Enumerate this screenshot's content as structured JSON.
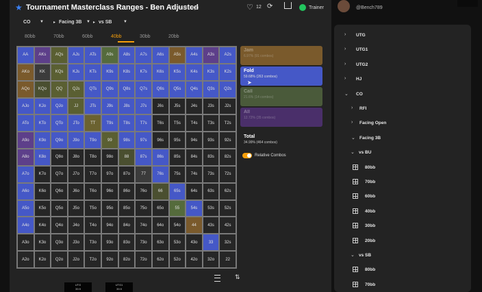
{
  "header": {
    "title": "Tournament Masterclass Ranges - Ben Adjusted",
    "time_ago": "7 months ago",
    "likes": "12",
    "trainer_label": "Trainer"
  },
  "nav": {
    "position": "CO",
    "facing": "Facing 3B",
    "villain": "vs SB"
  },
  "depth_tabs": [
    "80bb",
    "70bb",
    "60bb",
    "40bb",
    "30bb",
    "20bb"
  ],
  "active_depth": "40bb",
  "hands": [
    [
      "AA",
      "AKs",
      "AQs",
      "AJs",
      "ATs",
      "A9s",
      "A8s",
      "A7s",
      "A6s",
      "A5s",
      "A4s",
      "A3s",
      "A2s"
    ],
    [
      "AKo",
      "KK",
      "KQs",
      "KJs",
      "KTs",
      "K9s",
      "K8s",
      "K7s",
      "K6s",
      "K5s",
      "K4s",
      "K3s",
      "K2s"
    ],
    [
      "AQo",
      "KQo",
      "QQ",
      "QJs",
      "QTs",
      "Q9s",
      "Q8s",
      "Q7s",
      "Q6s",
      "Q5s",
      "Q4s",
      "Q3s",
      "Q2s"
    ],
    [
      "AJo",
      "KJo",
      "QJo",
      "JJ",
      "JTs",
      "J9s",
      "J8s",
      "J7s",
      "J6s",
      "J5s",
      "J4s",
      "J3s",
      "J2s"
    ],
    [
      "ATo",
      "KTo",
      "QTo",
      "JTo",
      "TT",
      "T9s",
      "T8s",
      "T7s",
      "T6s",
      "T5s",
      "T4s",
      "T3s",
      "T2s"
    ],
    [
      "A9o",
      "K9o",
      "Q9o",
      "J9o",
      "T9o",
      "99",
      "98s",
      "97s",
      "96s",
      "95s",
      "94s",
      "93s",
      "92s"
    ],
    [
      "A8o",
      "K8o",
      "Q8o",
      "J8o",
      "T8o",
      "98o",
      "88",
      "87s",
      "86s",
      "85s",
      "84s",
      "83s",
      "82s"
    ],
    [
      "A7o",
      "K7o",
      "Q7o",
      "J7o",
      "T7o",
      "97o",
      "87o",
      "77",
      "76s",
      "75s",
      "74s",
      "73s",
      "72s"
    ],
    [
      "A6o",
      "K6o",
      "Q6o",
      "J6o",
      "T6o",
      "96o",
      "86o",
      "76o",
      "66",
      "65s",
      "64s",
      "63s",
      "62s"
    ],
    [
      "A5o",
      "K5o",
      "Q5o",
      "J5o",
      "T5o",
      "95o",
      "85o",
      "75o",
      "65o",
      "55",
      "54s",
      "53s",
      "52s"
    ],
    [
      "A4o",
      "K4o",
      "Q4o",
      "J4o",
      "T4o",
      "94o",
      "84o",
      "74o",
      "64o",
      "54o",
      "44",
      "43s",
      "42s"
    ],
    [
      "A3o",
      "K3o",
      "Q3o",
      "J3o",
      "T3o",
      "93o",
      "83o",
      "73o",
      "63o",
      "53o",
      "43o",
      "33",
      "32s"
    ],
    [
      "A2o",
      "K2o",
      "Q2o",
      "J2o",
      "T2o",
      "92o",
      "82o",
      "72o",
      "62o",
      "52o",
      "42o",
      "32o",
      "22"
    ]
  ],
  "cell_colors": [
    [
      "#4558c7",
      "#5d3f8a",
      "#5a5f32",
      "#4558c7",
      "#4558c7",
      "#556b3c",
      "#4558c7",
      "#4558c7",
      "#4558c7",
      "#7a5a2c",
      "#4558c7",
      "#5d3f8a",
      "#4558c7"
    ],
    [
      "#7a5a2c",
      "#3b3b3b",
      "#5a5f32",
      "#4558c7",
      "#4558c7",
      "#4558c7",
      "#4558c7",
      "#4558c7",
      "#4558c7",
      "#4558c7",
      "#4558c7",
      "#4558c7",
      "#4558c7"
    ],
    [
      "#7a5a2c",
      "#4a4f30",
      "#5a5f32",
      "#5a5f32",
      "#4558c7",
      "#4558c7",
      "#4558c7",
      "#4558c7",
      "#4558c7",
      "#4558c7",
      "#4558c7",
      "#4558c7",
      "#4558c7"
    ],
    [
      "#4558c7",
      "#4558c7",
      "#4558c7",
      "#5a5f32",
      "#4558c7",
      "#4558c7",
      "#4558c7",
      "#4558c7",
      "#262626",
      "#262626",
      "#262626",
      "#262626",
      "#262626"
    ],
    [
      "#4558c7",
      "#4558c7",
      "#4558c7",
      "#4558c7",
      "#6b6230",
      "#4558c7",
      "#4558c7",
      "#4558c7",
      "#262626",
      "#262626",
      "#262626",
      "#262626",
      "#262626"
    ],
    [
      "#5d3f8a",
      "#4558c7",
      "#4558c7",
      "#4558c7",
      "#4558c7",
      "#5a5f32",
      "#4558c7",
      "#4558c7",
      "#262626",
      "#262626",
      "#262626",
      "#262626",
      "#262626"
    ],
    [
      "#5d3f8a",
      "#4558c7",
      "#262626",
      "#262626",
      "#262626",
      "#262626",
      "#4a4f30",
      "#4558c7",
      "#4558c7",
      "#262626",
      "#262626",
      "#262626",
      "#262626"
    ],
    [
      "#4558c7",
      "#262626",
      "#262626",
      "#262626",
      "#262626",
      "#262626",
      "#262626",
      "#3b3b3b",
      "#4558c7",
      "#262626",
      "#262626",
      "#262626",
      "#262626"
    ],
    [
      "#4558c7",
      "#262626",
      "#262626",
      "#262626",
      "#262626",
      "#262626",
      "#262626",
      "#262626",
      "#4a4f30",
      "#4558c7",
      "#262626",
      "#262626",
      "#262626"
    ],
    [
      "#4558c7",
      "#262626",
      "#262626",
      "#262626",
      "#262626",
      "#262626",
      "#262626",
      "#262626",
      "#262626",
      "#556b3c",
      "#4558c7",
      "#262626",
      "#262626"
    ],
    [
      "#4558c7",
      "#262626",
      "#262626",
      "#262626",
      "#262626",
      "#262626",
      "#262626",
      "#262626",
      "#262626",
      "#262626",
      "#7a5a2c",
      "#262626",
      "#262626"
    ],
    [
      "#262626",
      "#262626",
      "#262626",
      "#262626",
      "#262626",
      "#262626",
      "#262626",
      "#262626",
      "#262626",
      "#262626",
      "#262626",
      "#4558c7",
      "#262626"
    ],
    [
      "#262626",
      "#262626",
      "#262626",
      "#262626",
      "#262626",
      "#262626",
      "#262626",
      "#262626",
      "#262626",
      "#262626",
      "#262626",
      "#262626",
      "#262626"
    ]
  ],
  "actions": [
    {
      "name": "Jam",
      "pct": "6.97% (91 combos)",
      "color": "#7a5a2c",
      "dim": true
    },
    {
      "name": "Fold",
      "pct": "59.68% (263 combos)",
      "color": "#4558c7",
      "dim": false
    },
    {
      "name": "Call",
      "pct": "21.6% (14 combos)",
      "color": "#4a5a3a",
      "dim": true
    },
    {
      "name": "All",
      "pct": "12.72% (35 combos)",
      "color": "#4a2f6a",
      "dim": true
    }
  ],
  "total": {
    "label": "Total",
    "pct": "34.99% (464 combos)"
  },
  "relative_combos_label": "Relative Combos",
  "thumbnails": [
    {
      "label": "UTG",
      "value": "39.9"
    },
    {
      "label": "UTG1",
      "value": "39.9"
    }
  ],
  "sidebar": {
    "username": "@Bench789",
    "tree": [
      {
        "label": "UTG",
        "level": 0,
        "icon": "chevron-right"
      },
      {
        "label": "UTG1",
        "level": 0,
        "icon": "chevron-right"
      },
      {
        "label": "UTG2",
        "level": 0,
        "icon": "chevron-right"
      },
      {
        "label": "HJ",
        "level": 0,
        "icon": "chevron-right"
      },
      {
        "label": "CO",
        "level": 0,
        "icon": "chevron-down"
      },
      {
        "label": "RFI",
        "level": 1,
        "icon": "chevron-right"
      },
      {
        "label": "Facing Open",
        "level": 1,
        "icon": "chevron-right"
      },
      {
        "label": "Facing 3B",
        "level": 1,
        "icon": "chevron-down"
      },
      {
        "label": "vs BU",
        "level": 2,
        "icon": "chevron-down"
      },
      {
        "label": "80bb",
        "level": 3,
        "icon": "grid"
      },
      {
        "label": "70bb",
        "level": 3,
        "icon": "grid"
      },
      {
        "label": "60bb",
        "level": 3,
        "icon": "grid"
      },
      {
        "label": "40bb",
        "level": 3,
        "icon": "grid"
      },
      {
        "label": "30bb",
        "level": 3,
        "icon": "grid"
      },
      {
        "label": "20bb",
        "level": 3,
        "icon": "grid"
      },
      {
        "label": "vs SB",
        "level": 2,
        "icon": "chevron-down"
      },
      {
        "label": "80bb",
        "level": 3,
        "icon": "grid"
      },
      {
        "label": "70bb",
        "level": 3,
        "icon": "grid"
      }
    ]
  }
}
